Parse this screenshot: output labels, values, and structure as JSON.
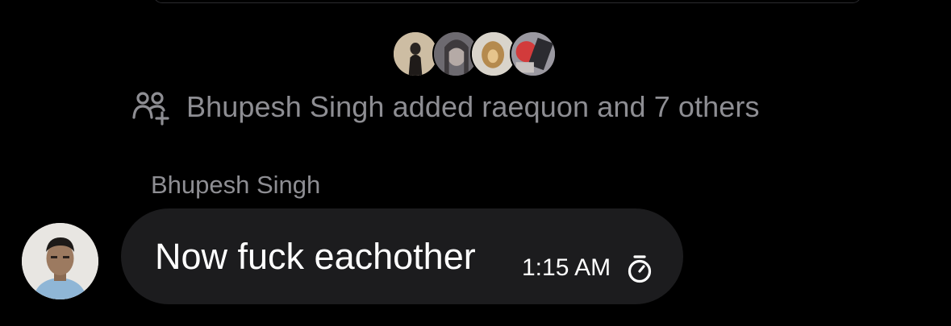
{
  "group_avatars": [
    {
      "name": "member-avatar-1"
    },
    {
      "name": "member-avatar-2"
    },
    {
      "name": "member-avatar-3"
    },
    {
      "name": "member-avatar-4"
    }
  ],
  "system_message": {
    "icon": "add-people-icon",
    "text": "Bhupesh Singh added raequon and 7 others"
  },
  "message": {
    "sender": "Bhupesh Singh",
    "text": "Now fuck eachother",
    "time": "1:15 AM",
    "timer_icon": "disappearing-timer-icon"
  },
  "colors": {
    "background": "#000000",
    "bubble": "#1c1c1e",
    "secondary_text": "#8e8e93",
    "primary_text": "#ffffff"
  }
}
